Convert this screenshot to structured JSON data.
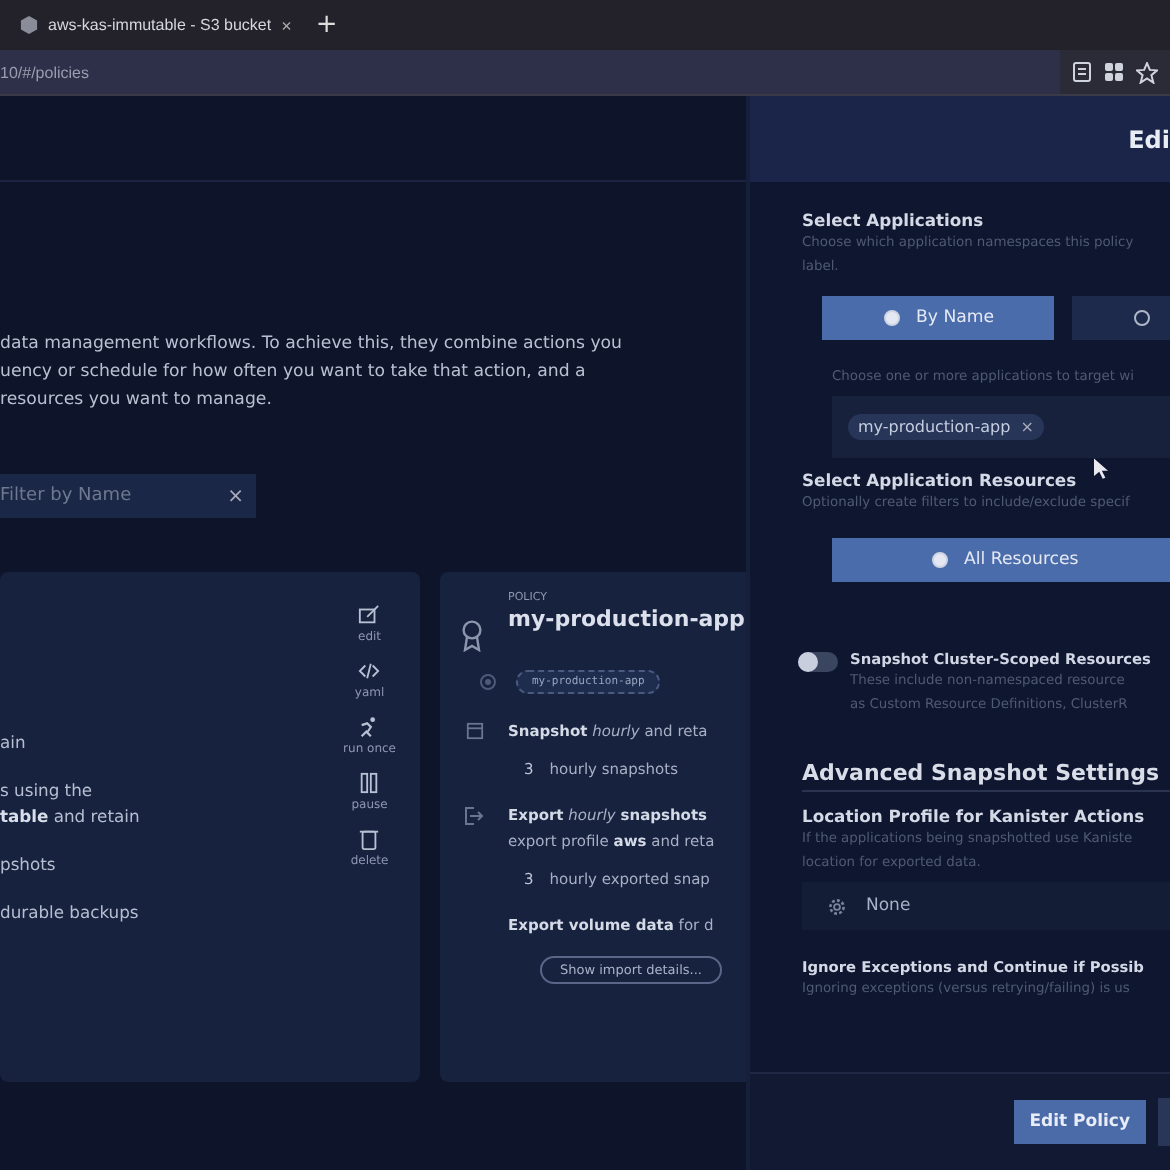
{
  "browser": {
    "tab": {
      "title": "aws-kas-immutable - S3 bucket",
      "close": "×"
    },
    "new_tab": "+",
    "address": "10/#/policies"
  },
  "intro": {
    "lines": [
      "data management workflows. To achieve this, they combine actions you",
      "uency or schedule for how often you want to take that action, and a",
      "resources you want to manage."
    ]
  },
  "filter": {
    "placeholder": "Filter by Name",
    "clear": "×"
  },
  "policy_cards": [
    {
      "groups": [
        [
          "ain"
        ],
        [
          "s using the",
          "**table** and retain"
        ],
        [
          "pshots"
        ],
        [
          "durable backups"
        ]
      ],
      "actions": [
        {
          "kind": "edit",
          "label": "edit"
        },
        {
          "kind": "yaml",
          "label": "yaml"
        },
        {
          "kind": "run",
          "label": "run once"
        },
        {
          "kind": "pause",
          "label": "pause"
        },
        {
          "kind": "delete",
          "label": "delete"
        }
      ]
    },
    {
      "caption": "POLICY",
      "name": "my-production-app",
      "app_chip": "my-production-app",
      "sections": [
        {
          "kind": "snapshot",
          "lines": [
            "**Snapshot** *hourly* and reta"
          ],
          "count": "3",
          "count_text": "hourly snapshots"
        },
        {
          "kind": "export",
          "lines": [
            "**Export** *hourly* **snapshots**",
            "export profile **aws** and reta"
          ],
          "count": "3",
          "count_text": "hourly exported snap"
        },
        {
          "kind": "volume",
          "lines": [
            "**Export volume data** for d"
          ]
        }
      ],
      "button": "Show import details..."
    }
  ],
  "drawer": {
    "title": "Edi",
    "select_applications": {
      "heading": "Select Applications",
      "help": [
        "Choose which application namespaces this policy",
        "label."
      ],
      "options": [
        {
          "label": "By Name",
          "selected": true
        },
        {
          "selected": false
        }
      ],
      "hint": "Choose one or more applications to target wi",
      "chips": [
        {
          "label": "my-production-app",
          "remove": "×"
        }
      ]
    },
    "select_resources": {
      "heading": "Select Application Resources",
      "help": "Optionally create filters to include/exclude specif",
      "options": [
        {
          "label": "All Resources",
          "selected": true
        }
      ]
    },
    "cluster_toggle": {
      "on": false,
      "label": "Snapshot Cluster-Scoped Resources",
      "help": [
        "These include non-namespaced resource",
        "as Custom Resource Definitions, ClusterR"
      ]
    },
    "advanced": {
      "heading": "Advanced Snapshot Settings",
      "location": {
        "label": "Location Profile for Kanister Actions",
        "help": [
          "If the applications being snapshotted use Kaniste",
          "location for exported data."
        ],
        "value": "None"
      },
      "ignore": {
        "label": "Ignore Exceptions and Continue if Possib",
        "help": "Ignoring exceptions (versus retrying/failing) is us"
      }
    },
    "footer": {
      "primary": "Edit Policy"
    }
  }
}
